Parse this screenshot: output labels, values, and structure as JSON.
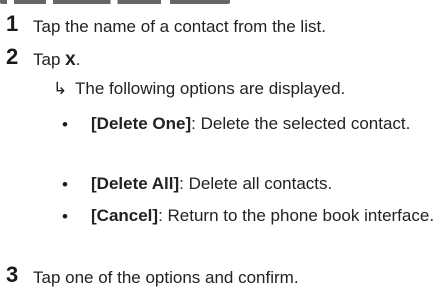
{
  "steps": [
    {
      "number": "1",
      "text": "Tap the name of a contact from the list."
    },
    {
      "number": "2",
      "text_prefix": "Tap ",
      "icon_label": "x",
      "text_suffix": "."
    },
    {
      "number": "3",
      "text": "Tap one of the options and confirm."
    }
  ],
  "result": {
    "arrow": "↳",
    "text": "The following options are displayed."
  },
  "options": [
    {
      "label": "[Delete One]",
      "desc": ": Delete the selected contact."
    },
    {
      "label": "[Delete All]",
      "desc": ": Delete all contacts."
    },
    {
      "label": "[Cancel]",
      "desc": ": Return to the phone book interface."
    }
  ],
  "bullet_char": "•"
}
